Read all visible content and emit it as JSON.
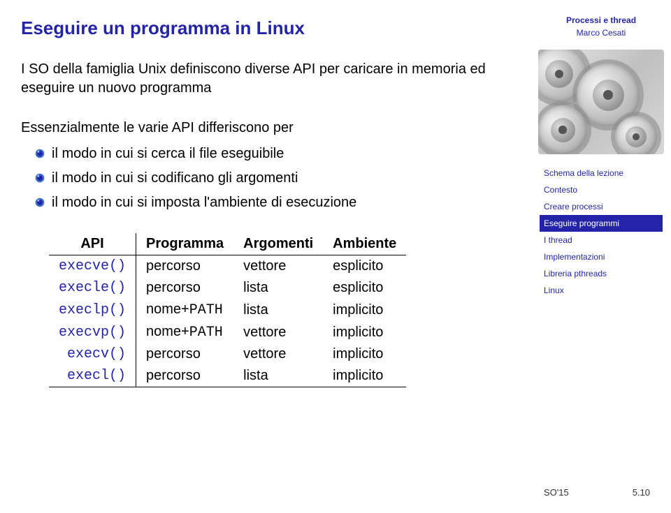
{
  "title": "Eseguire un programma in Linux",
  "para1": "I SO della famiglia Unix definiscono diverse API per caricare in memoria ed eseguire un nuovo programma",
  "para2": "Essenzialmente le varie API differiscono per",
  "bullets": [
    "il modo in cui si cerca il file eseguibile",
    "il modo in cui si codificano gli argomenti",
    "il modo in cui si imposta l'ambiente di esecuzione"
  ],
  "table": {
    "headers": [
      "API",
      "Programma",
      "Argomenti",
      "Ambiente"
    ],
    "rows": [
      {
        "api": "execve()",
        "prog": "percorso",
        "prog_mono": "",
        "arg": "vettore",
        "amb": "esplicito"
      },
      {
        "api": "execle()",
        "prog": "percorso",
        "prog_mono": "",
        "arg": "lista",
        "amb": "esplicito"
      },
      {
        "api": "execlp()",
        "prog": "nome+",
        "prog_mono": "PATH",
        "arg": "lista",
        "amb": "implicito"
      },
      {
        "api": "execvp()",
        "prog": "nome+",
        "prog_mono": "PATH",
        "arg": "vettore",
        "amb": "implicito"
      },
      {
        "api": "execv()",
        "prog": "percorso",
        "prog_mono": "",
        "arg": "vettore",
        "amb": "implicito"
      },
      {
        "api": "execl()",
        "prog": "percorso",
        "prog_mono": "",
        "arg": "lista",
        "amb": "implicito"
      }
    ]
  },
  "sidebar": {
    "top": "Processi e thread",
    "author": "Marco Cesati",
    "nav": [
      "Schema della lezione",
      "Contesto",
      "Creare processi",
      "Eseguire programmi",
      "I thread",
      "Implementazioni",
      "Libreria pthreads",
      "Linux"
    ],
    "active_index": 3
  },
  "footer": {
    "left": "SO'15",
    "right": "5.10"
  }
}
